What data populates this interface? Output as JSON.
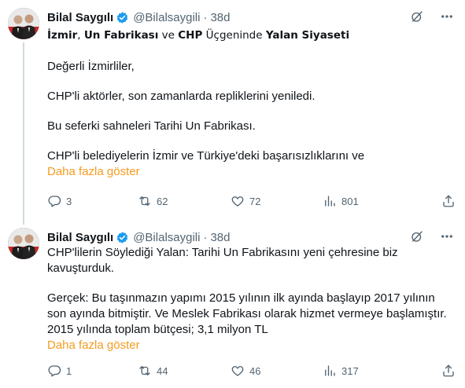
{
  "tweets": [
    {
      "author": {
        "name": "Bilal Saygılı",
        "handle": "@Bilalsaygili",
        "time": "38d"
      },
      "title_parts": [
        "İzmir",
        ", ",
        "Un Fabrikası",
        " ve ",
        "CHP",
        " Üçgeninde ",
        "Yalan Siyaseti"
      ],
      "paragraphs": [
        "Değerli İzmirliler,",
        "CHP'li aktörler, son zamanlarda repliklerini yeniledi.",
        "Bu seferki sahneleri Tarihi Un Fabrikası.",
        "CHP'li belediyelerin İzmir ve Türkiye'deki başarısızlıklarını ve"
      ],
      "show_more": "Daha fazla göster",
      "stats": {
        "replies": "3",
        "retweets": "62",
        "likes": "72",
        "views": "801"
      }
    },
    {
      "author": {
        "name": "Bilal Saygılı",
        "handle": "@Bilalsaygili",
        "time": "38d"
      },
      "paragraphs": [
        "CHP'lilerin Söylediği Yalan: Tarihi Un Fabrikasını yeni çehresine biz kavuşturduk.",
        "Gerçek: Bu taşınmazın yapımı 2015 yılının ilk ayında başlayıp 2017 yılının son ayında bitmiştir. Ve Meslek Fabrikası olarak hizmet vermeye başlamıştır. 2015 yılında toplam bütçesi; 3,1 milyon TL"
      ],
      "show_more": "Daha fazla göster",
      "stats": {
        "replies": "1",
        "retweets": "44",
        "likes": "46",
        "views": "317"
      }
    }
  ],
  "colors": {
    "show_more": "#f49b1f",
    "verified": "#1d9bf0",
    "muted": "#536471"
  },
  "icons": [
    "verified-badge-icon",
    "grok-icon",
    "more-icon",
    "reply-icon",
    "retweet-icon",
    "like-icon",
    "views-icon",
    "share-icon"
  ]
}
